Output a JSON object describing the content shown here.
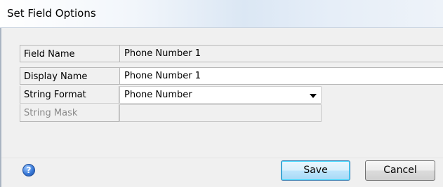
{
  "window": {
    "title": "Set Field Options"
  },
  "fields": [
    {
      "label": "Field Name",
      "value": "Phone Number 1",
      "enabled": true,
      "editable": false
    },
    {
      "label": "Display Name",
      "value": "Phone Number 1",
      "enabled": true,
      "editable": true
    },
    {
      "label": "String Format",
      "value": "Phone Number",
      "enabled": true,
      "type": "select"
    },
    {
      "label": "String Mask",
      "value": "",
      "enabled": false
    }
  ],
  "footer": {
    "help_icon": "question-help-icon",
    "help_glyph": "?",
    "save_label": "Save",
    "cancel_label": "Cancel"
  },
  "colors": {
    "accent": "#3c7fb1",
    "help_blue": "#2b67c4"
  }
}
